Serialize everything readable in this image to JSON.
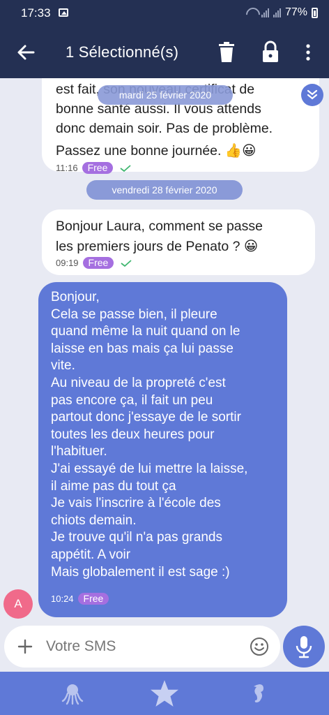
{
  "status_bar": {
    "time": "17:33",
    "battery": "77%"
  },
  "app_bar": {
    "title": "1 Sélectionné(s)"
  },
  "messages": [
    {
      "text_lines": [
        "est fait, son nouveau certificat de",
        "bonne santé aussi. Il vous attends",
        "donc demain soir. Pas de problème.",
        "Passez une bonne journée. 👍😀"
      ],
      "time": "11:16",
      "badge": "Free"
    },
    {
      "text_lines": [
        "Bonjour Laura, comment se passe",
        "les premiers jours de Penato ? 😀"
      ],
      "time": "09:19",
      "badge": "Free"
    },
    {
      "text": "Bonjour,\nCela se passe bien, il pleure\nquand même la nuit quand on le\nlaisse en bas mais ça lui passe\nvite.\nAu niveau de la propreté c'est\npas encore ça, il fait un peu\npartout donc j'essaye de le sortir\ntoutes les deux heures pour\nl'habituer.\nJ'ai essayé de lui mettre la laisse,\nil aime pas du tout ça\nJe vais l'inscrire à l'école des\nchiots demain.\nJe trouve qu'il n'a pas grands\nappétit. A voir\nMais globalement il est sage :)",
      "time": "10:24",
      "badge": "Free"
    }
  ],
  "date_chips": {
    "first": "mardi 25 février 2020",
    "second": "vendredi 28 février 2020"
  },
  "avatar": {
    "letter": "A"
  },
  "composer": {
    "placeholder": "Votre SMS"
  },
  "colors": {
    "header": "#243053",
    "accent": "#5f79d7",
    "badge": "#a56fe0",
    "avatar": "#f06a8a"
  },
  "bottom_nav": [
    {
      "icon": "octopus-icon"
    },
    {
      "icon": "starfish-icon"
    },
    {
      "icon": "seahorse-icon"
    }
  ]
}
